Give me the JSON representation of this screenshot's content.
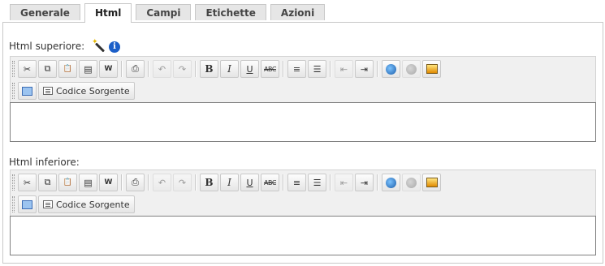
{
  "tabs": [
    {
      "label": "Generale"
    },
    {
      "label": "Html"
    },
    {
      "label": "Campi"
    },
    {
      "label": "Etichette"
    },
    {
      "label": "Azioni"
    }
  ],
  "active_tab": "Html",
  "sections": {
    "top": {
      "label": "Html superiore:",
      "source_button": "Codice Sorgente",
      "content": ""
    },
    "bottom": {
      "label": "Html inferiore:",
      "source_button": "Codice Sorgente",
      "content": ""
    }
  },
  "toolbar_glyphs": {
    "cut": "✂",
    "copy": "⧉",
    "paste": "📋",
    "paste_text": "▤",
    "paste_word": "W",
    "print": "⎙",
    "undo": "↶",
    "redo": "↷",
    "bold": "B",
    "italic": "I",
    "underline": "U",
    "strike": "ABC",
    "ordered_list": "≡",
    "unordered_list": "☰",
    "outdent": "⇤",
    "indent": "⇥"
  },
  "info_glyph": "i",
  "colors": {
    "tab_bg": "#e6e6e6",
    "toolbar_bg": "#f0f0f0",
    "border": "#c8c8c8",
    "info_blue": "#1c5fc8"
  }
}
